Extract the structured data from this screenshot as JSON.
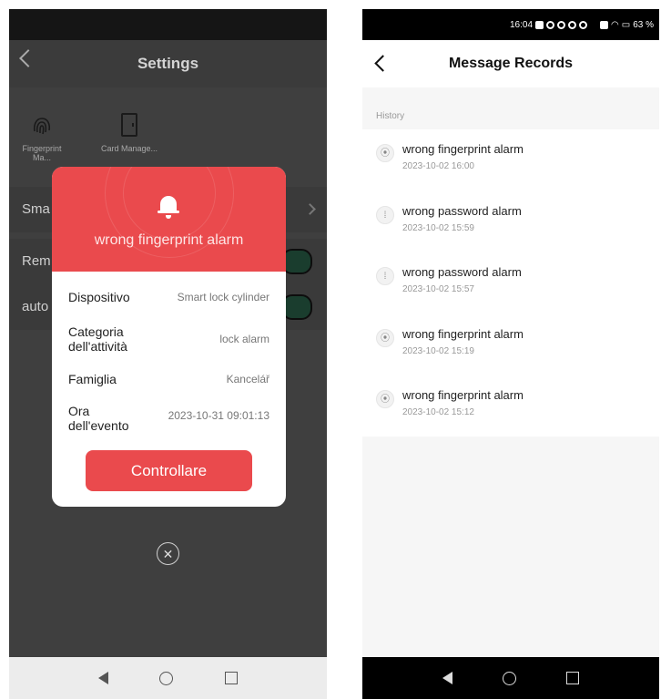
{
  "left": {
    "header": {
      "title": "Settings"
    },
    "tools": [
      {
        "label": "Fingerprint Ma...",
        "icon": "fingerprint-icon"
      },
      {
        "label": "Card Manage...",
        "icon": "card-icon"
      }
    ],
    "rows": [
      {
        "label": "Sma",
        "control": "chevron"
      },
      {
        "label": "Rem",
        "control": "toggle"
      },
      {
        "label": "auto",
        "control": "toggle"
      }
    ],
    "modal": {
      "alarm_title": "wrong fingerprint alarm",
      "rows": [
        {
          "label": "Dispositivo",
          "value": "Smart lock cylinder"
        },
        {
          "label": "Categoria dell'attività",
          "value": "lock alarm"
        },
        {
          "label": "Famiglia",
          "value": "Kancelář"
        },
        {
          "label": "Ora dell'evento",
          "value": "2023-10-31 09:01:13"
        }
      ],
      "button_label": "Controllare",
      "close_glyph": "✕"
    }
  },
  "right": {
    "status": {
      "time": "16:04",
      "battery": "63 %"
    },
    "header": {
      "title": "Message Records"
    },
    "section": "History",
    "records": [
      {
        "title": "wrong fingerprint alarm",
        "time": "2023-10-02 16:00",
        "icon": "fingerprint-icon"
      },
      {
        "title": "wrong password alarm",
        "time": "2023-10-02 15:59",
        "icon": "keypad-icon"
      },
      {
        "title": "wrong password alarm",
        "time": "2023-10-02 15:57",
        "icon": "keypad-icon"
      },
      {
        "title": "wrong fingerprint alarm",
        "time": "2023-10-02 15:19",
        "icon": "fingerprint-icon"
      },
      {
        "title": "wrong fingerprint alarm",
        "time": "2023-10-02 15:12",
        "icon": "fingerprint-icon"
      }
    ]
  },
  "colors": {
    "accent": "#ea4a4d"
  }
}
